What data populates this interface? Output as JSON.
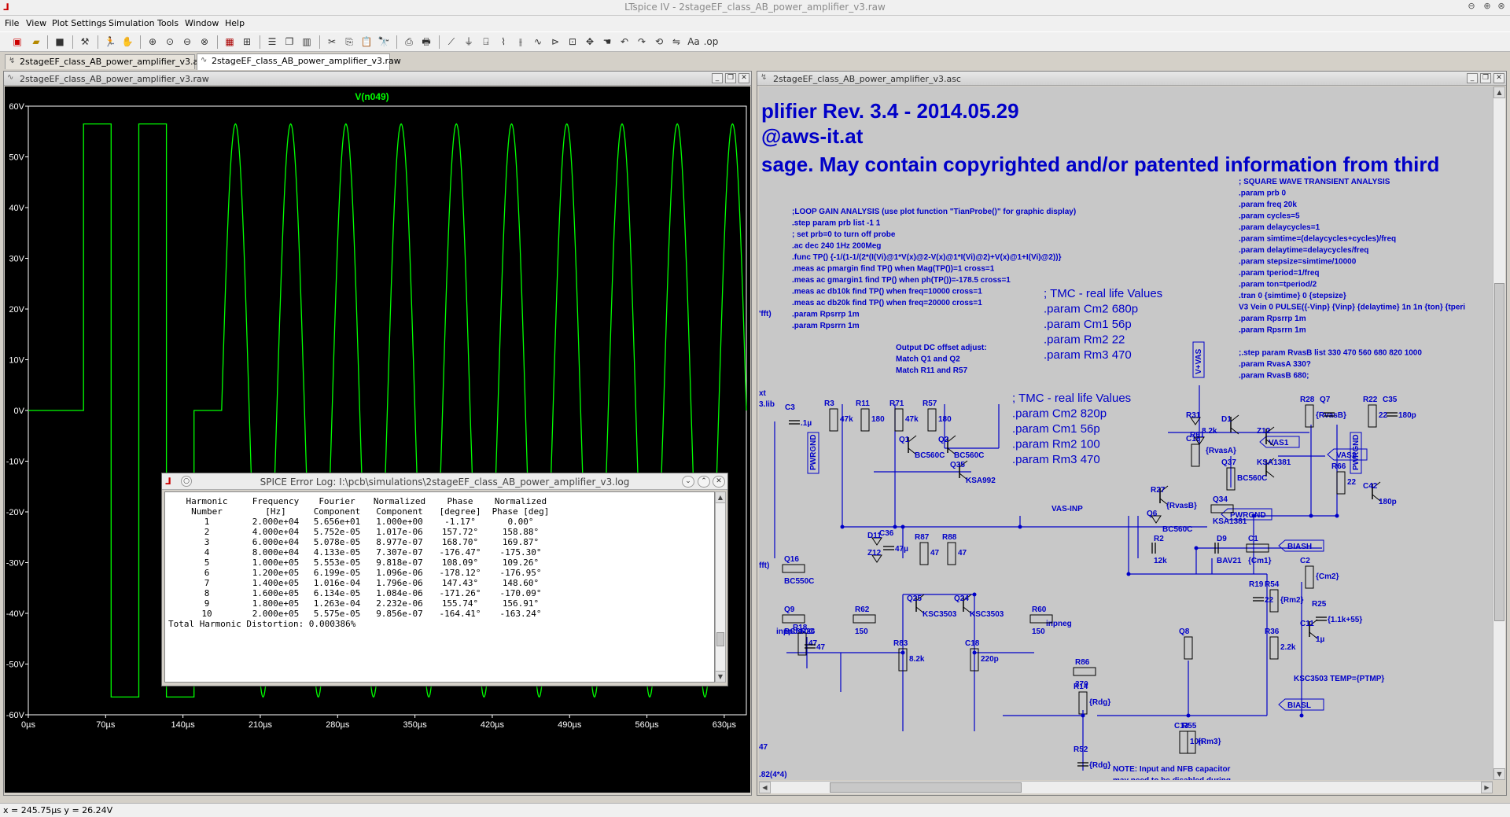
{
  "app": {
    "title": "LTspice IV - 2stageEF_class_AB_power_amplifier_v3.raw",
    "icon_name": "ltspice-logo-icon"
  },
  "menu": {
    "items": [
      "File",
      "View",
      "Plot Settings",
      "Simulation",
      "Tools",
      "Window",
      "Help"
    ]
  },
  "tabs": [
    {
      "label": "2stageEF_class_AB_power_amplifier_v3.asc",
      "active": false
    },
    {
      "label": "2stageEF_class_AB_power_amplifier_v3.raw",
      "active": true
    }
  ],
  "plot_window": {
    "title": "2stageEF_class_AB_power_amplifier_v3.raw",
    "trace_label": "V(n049)",
    "trace_color": "#00ff00",
    "axis_color": "#ffffff",
    "background": "#000000",
    "chart_data": {
      "type": "line",
      "xlabel": "",
      "ylabel": "",
      "x_ticks": [
        "0µs",
        "70µs",
        "140µs",
        "210µs",
        "280µs",
        "350µs",
        "420µs",
        "490µs",
        "560µs",
        "630µs"
      ],
      "y_ticks": [
        "60V",
        "50V",
        "40V",
        "30V",
        "20V",
        "10V",
        "0V",
        "-10V",
        "-20V",
        "-30V",
        "-40V",
        "-50V",
        "-60V"
      ],
      "xlim": [
        0,
        650
      ],
      "ylim": [
        -60,
        60
      ],
      "x_unit": "µs",
      "series": [
        {
          "name": "V(n049)",
          "description_points": {
            "square_segments_us": [
              {
                "x": [
                  0,
                  50
                ],
                "y": 0
              },
              {
                "x": [
                  50,
                  50
                ],
                "y": [
                  0,
                  56.5
                ]
              },
              {
                "x": [
                  50,
                  75
                ],
                "y": 56.5
              },
              {
                "x": [
                  75,
                  75
                ],
                "y": [
                  56.5,
                  -56.5
                ]
              },
              {
                "x": [
                  75,
                  100
                ],
                "y": -56.5
              },
              {
                "x": [
                  100,
                  100
                ],
                "y": [
                  -56.5,
                  56.5
                ]
              },
              {
                "x": [
                  100,
                  125
                ],
                "y": 56.5
              },
              {
                "x": [
                  125,
                  125
                ],
                "y": [
                  56.5,
                  -56.5
                ]
              },
              {
                "x": [
                  125,
                  150
                ],
                "y": -56.5
              },
              {
                "x": [
                  150,
                  150
                ],
                "y": [
                  -56.5,
                  0
                ]
              },
              {
                "x": [
                  150,
                  175
                ],
                "y": 0
              }
            ],
            "sine": {
              "start_us": 175,
              "end_us": 650,
              "freq_khz": 20,
              "amplitude_v": 56.5
            }
          }
        }
      ]
    }
  },
  "error_log": {
    "title": "SPICE Error Log: I:\\pcb\\simulations\\2stageEF_class_AB_power_amplifier_v3.log",
    "header1": [
      "Harmonic",
      "Frequency",
      "Fourier",
      "Normalized",
      "Phase",
      "Normalized"
    ],
    "header2": [
      "Number",
      "[Hz]",
      "Component",
      "Component",
      "[degree]",
      "Phase [deg]"
    ],
    "rows": [
      [
        "1",
        "2.000e+04",
        "5.656e+01",
        "1.000e+00",
        "-1.17°",
        "0.00°"
      ],
      [
        "2",
        "4.000e+04",
        "5.752e-05",
        "1.017e-06",
        "157.72°",
        "158.88°"
      ],
      [
        "3",
        "6.000e+04",
        "5.078e-05",
        "8.977e-07",
        "168.70°",
        "169.87°"
      ],
      [
        "4",
        "8.000e+04",
        "4.133e-05",
        "7.307e-07",
        "-176.47°",
        "-175.30°"
      ],
      [
        "5",
        "1.000e+05",
        "5.553e-05",
        "9.818e-07",
        "108.09°",
        "109.26°"
      ],
      [
        "6",
        "1.200e+05",
        "6.199e-05",
        "1.096e-06",
        "-178.12°",
        "-176.95°"
      ],
      [
        "7",
        "1.400e+05",
        "1.016e-04",
        "1.796e-06",
        "147.43°",
        "148.60°"
      ],
      [
        "8",
        "1.600e+05",
        "6.134e-05",
        "1.084e-06",
        "-171.26°",
        "-170.09°"
      ],
      [
        "9",
        "1.800e+05",
        "1.263e-04",
        "2.232e-06",
        "155.74°",
        "156.91°"
      ],
      [
        "10",
        "2.000e+05",
        "5.575e-05",
        "9.856e-07",
        "-164.41°",
        "-163.24°"
      ]
    ],
    "thd": "Total Harmonic Distortion: 0.000386%"
  },
  "schematic_window": {
    "title": "2stageEF_class_AB_power_amplifier_v3.asc",
    "text_color": "#0000c8",
    "wire_color": "#0000c8",
    "background": "#c8c8c8",
    "big_lines": [
      "plifier Rev. 3.4 - 2014.05.29",
      "@aws-it.at",
      "sage. May contain copyrighted and/or patented information from third"
    ],
    "loop_gain_block": [
      ";LOOP GAIN ANALYSIS (use plot function \"TianProbe()\" for graphic display)",
      ".step param prb list -1 1",
      "; set prb=0 to turn off probe",
      ".ac dec 240 1Hz 200Meg",
      ".func TP() {-1/(1-1/(2*(I(Vi)@1*V(x)@2-V(x)@1*I(Vi)@2)+V(x)@1+I(Vi)@2))}",
      ".meas ac pmargin find TP() when Mag(TP())=1 cross=1",
      ".meas ac gmargin1 find TP() when ph(TP())=-178.5 cross=1",
      ".meas ac db10k find TP() when freq=10000 cross=1",
      ".meas ac db20k find TP() when freq=20000 cross=1",
      ".param Rpsrrp 1m",
      ".param Rpsrrn 1m"
    ],
    "square_block": [
      "; SQUARE WAVE TRANSIENT ANALYSIS",
      ".param prb 0",
      ".param freq 20k",
      ".param cycles=5",
      ".param delaycycles=1",
      ".param simtime=(delaycycles+cycles)/freq",
      ".param delaytime=delaycycles/freq",
      ".param stepsize=simtime/10000",
      ".param tperiod=1/freq",
      ".param ton=tperiod/2",
      ".tran 0 {simtime} 0 {stepsize}",
      "V3 Vein 0 PULSE({-Vinp} {Vinp} {delaytime} 1n 1n {ton} {tperi",
      ".param Rpsrrp 1m",
      ".param Rpsrrn 1m",
      "",
      ";.step param RvasB list 330 470 560 680 820 1000",
      ".param RvasA 330?",
      ".param RvasB 680;"
    ],
    "tmc1": [
      "; TMC - real life Values",
      ".param Cm2 680p",
      ".param Cm1 56p",
      ".param Rm2 22",
      ".param Rm3 470"
    ],
    "tmc2": [
      "; TMC - real life Values",
      ".param Cm2 820p",
      ".param Cm1 56p",
      ".param Rm2 100",
      ".param Rm3 470"
    ],
    "offset_note": [
      "Output DC offset adjust:",
      "Match Q1 and Q2",
      "Match R11 and R57"
    ],
    "nifb_note": [
      "NOTE: Input and NFB capacitor",
      "may need to be disabled during"
    ],
    "labels": {
      "vplus": "V+VAS",
      "pwrgnd": "PWRGND",
      "pwrgnd2": "PWRGND",
      "pwrgnd3": "PWRGND",
      "vasinp": "VAS-INP",
      "vas1": "VAS1",
      "vas2": "VAS2",
      "biash": "BIASH",
      "biasl": "BIASL",
      "inppos": "inppos",
      "inpneg": "inpneg",
      "ktemp": "KSC3503 TEMP={PTMP}",
      "fft": "'fft)",
      "fft2": "fft)",
      "xt": "xt",
      "lib": "3.lib",
      "n47": "47",
      "n82": ".82(4*4)"
    },
    "components": [
      {
        "n": "C3",
        "v": ".1µ"
      },
      {
        "n": "R3",
        "v": "47k"
      },
      {
        "n": "R11",
        "v": "180"
      },
      {
        "n": "R71",
        "v": "47k"
      },
      {
        "n": "R57",
        "v": "180"
      },
      {
        "n": "Q1",
        "v": "BC560C"
      },
      {
        "n": "Q2",
        "v": "BC560C"
      },
      {
        "n": "Q35",
        "v": "KSA992"
      },
      {
        "n": "D11",
        "v": ""
      },
      {
        "n": "C36",
        "v": "47µ"
      },
      {
        "n": "Z12",
        "v": ""
      },
      {
        "n": "R87",
        "v": "47"
      },
      {
        "n": "R88",
        "v": "47"
      },
      {
        "n": "Q25",
        "v": "KSC3503"
      },
      {
        "n": "Q24",
        "v": "KSC3503"
      },
      {
        "n": "Q16",
        "v": "BC550C"
      },
      {
        "n": "Q9",
        "v": "BC550C"
      },
      {
        "n": "R62",
        "v": "150"
      },
      {
        "n": "R60",
        "v": "150"
      },
      {
        "n": "R18",
        "v": "47"
      },
      {
        "n": "R26",
        "v": "47"
      },
      {
        "n": "R83",
        "v": "8.2k"
      },
      {
        "n": "C18",
        "v": "220p"
      },
      {
        "n": "R14",
        "v": "{Rdg}"
      },
      {
        "n": "R52",
        "v": "{Rdg}"
      },
      {
        "n": "R86",
        "v": "270"
      },
      {
        "n": "C16",
        "v": ""
      },
      {
        "n": "R31",
        "v": "8.2k"
      },
      {
        "n": "R61",
        "v": "{RvasA}"
      },
      {
        "n": "D1",
        "v": ""
      },
      {
        "n": "Z12",
        "v": ""
      },
      {
        "n": "Q37",
        "v": "BC560C"
      },
      {
        "n": "KSA1381",
        "v": ""
      },
      {
        "n": "R28",
        "v": "{RvasB}"
      },
      {
        "n": "Q7",
        "v": ""
      },
      {
        "n": "R22",
        "v": "22"
      },
      {
        "n": "C35",
        "v": "180p"
      },
      {
        "n": "R66",
        "v": "22"
      },
      {
        "n": "C42",
        "v": "180p"
      },
      {
        "n": "R27",
        "v": "{RvasB}"
      },
      {
        "n": "Q34",
        "v": "KSA1381"
      },
      {
        "n": "Q6",
        "v": "BC560C"
      },
      {
        "n": "R2",
        "v": "12k"
      },
      {
        "n": "D9",
        "v": "BAV21"
      },
      {
        "n": "C1",
        "v": "{Cm1}"
      },
      {
        "n": "C2",
        "v": "{Cm2}"
      },
      {
        "n": "R54",
        "v": "{Rm2}"
      },
      {
        "n": "R19",
        "v": "22"
      },
      {
        "n": "R36",
        "v": "2.2k"
      },
      {
        "n": "C11",
        "v": "1µ"
      },
      {
        "n": "R25",
        "v": "{1.1k+55}"
      },
      {
        "n": "Q8",
        "v": ""
      },
      {
        "n": "C13",
        "v": "10n"
      },
      {
        "n": "R55",
        "v": "{Rm3}"
      }
    ]
  },
  "status": {
    "coords": "x = 245.75µs   y = 26.24V"
  }
}
